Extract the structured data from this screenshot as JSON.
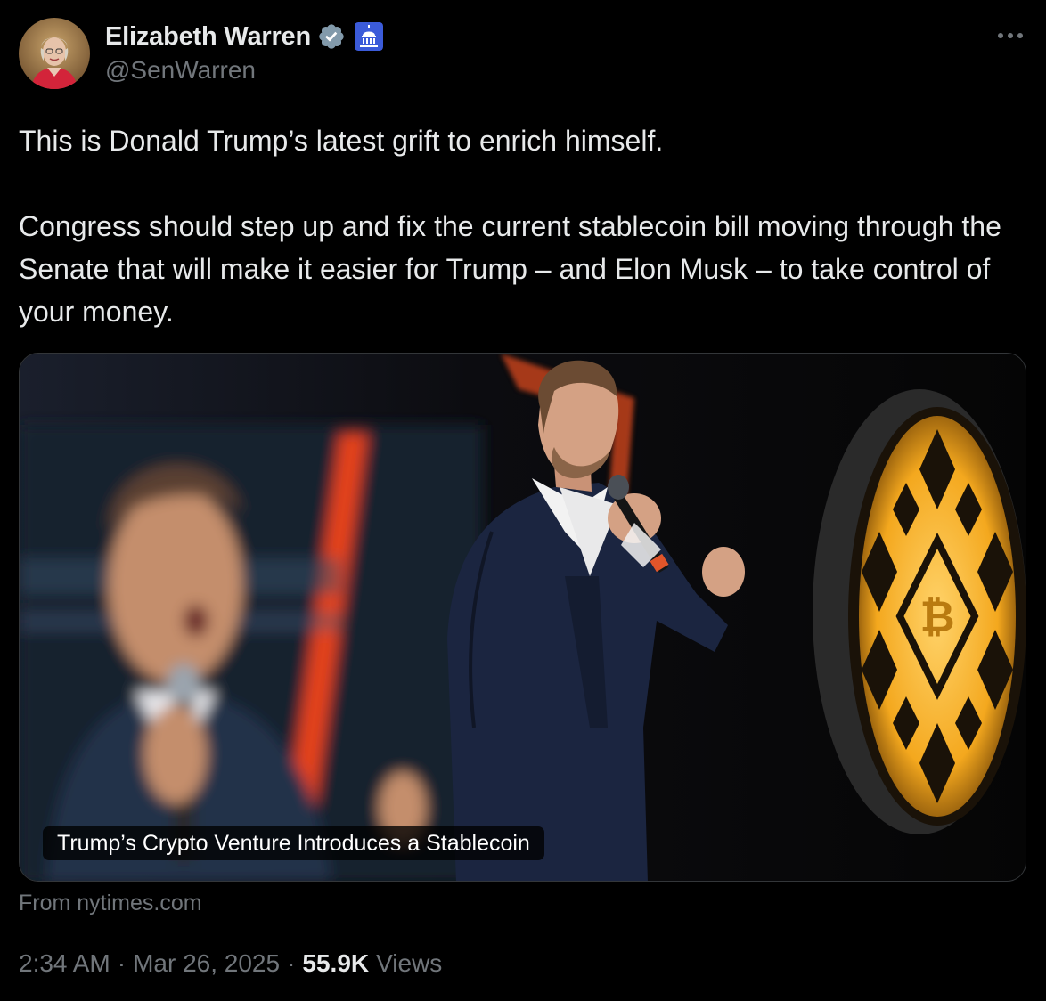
{
  "author": {
    "display_name": "Elizabeth Warren",
    "handle": "@SenWarren",
    "verified_icon": "verified-badge-icon",
    "affiliation_icon": "capitol-building-icon"
  },
  "tweet": {
    "paragraphs": [
      "This is Donald Trump’s latest grift to enrich himself.",
      "Congress should step up and fix the current stablecoin bill moving through the Senate that will make it easier for Trump – and Elon Musk – to take control of your money."
    ]
  },
  "card": {
    "title": "Trump’s Crypto Venture Introduces a Stablecoin",
    "source": "From nytimes.com"
  },
  "meta": {
    "time": "2:34 AM",
    "separator": "·",
    "date": "Mar 26, 2025",
    "views_count": "55.9K",
    "views_label": "Views"
  },
  "colors": {
    "background": "#000000",
    "text_primary": "#e7e9ea",
    "text_secondary": "#71767b",
    "verified": "#829aab",
    "border": "#333639"
  }
}
